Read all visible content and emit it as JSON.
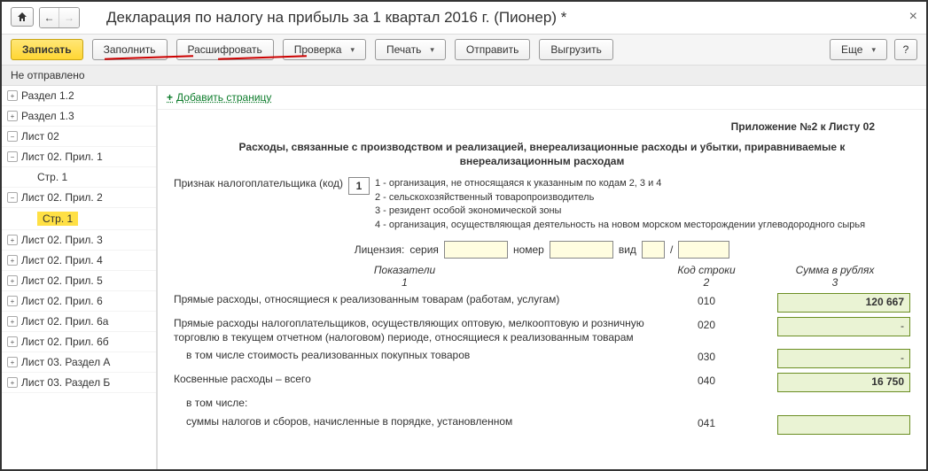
{
  "window": {
    "title": "Декларация по налогу на прибыль за 1 квартал 2016 г. (Пионер) *"
  },
  "toolbar": {
    "record": "Записать",
    "fill": "Заполнить",
    "decode": "Расшифровать",
    "check": "Проверка",
    "print": "Печать",
    "send": "Отправить",
    "export": "Выгрузить",
    "more": "Еще",
    "help": "?"
  },
  "status": "Не отправлено",
  "sidebar": {
    "items": [
      {
        "label": "Раздел 1.2",
        "tog": "+"
      },
      {
        "label": "Раздел 1.3",
        "tog": "+"
      },
      {
        "label": "Лист 02",
        "tog": "−"
      },
      {
        "label": "Лист 02. Прил. 1",
        "tog": "−"
      },
      {
        "label": "Стр. 1",
        "child": true
      },
      {
        "label": "Лист 02. Прил. 2",
        "tog": "−",
        "active": true
      },
      {
        "label": "Стр. 1",
        "child": true,
        "selected": true
      },
      {
        "label": "Лист 02. Прил. 3",
        "tog": "+"
      },
      {
        "label": "Лист 02. Прил. 4",
        "tog": "+"
      },
      {
        "label": "Лист 02. Прил. 5",
        "tog": "+"
      },
      {
        "label": "Лист 02. Прил. 6",
        "tog": "+"
      },
      {
        "label": "Лист 02. Прил. 6а",
        "tog": "+"
      },
      {
        "label": "Лист 02. Прил. 6б",
        "tog": "+"
      },
      {
        "label": "Лист 03. Раздел А",
        "tog": "+"
      },
      {
        "label": "Лист 03. Раздел Б",
        "tog": "+"
      }
    ]
  },
  "content": {
    "add_page": "Добавить страницу",
    "app_title_right": "Приложение №2 к Листу 02",
    "main_title": "Расходы, связанные с производством и реализацией, внереализационные расходы и убытки, приравниваемые к внереализационным расходам",
    "taxpayer_code_label": "Признак налогоплательщика (код)",
    "taxpayer_code": "1",
    "hints": [
      "1 - организация, не относящаяся к указанным по кодам 2, 3 и 4",
      "2 - сельскохозяйственный товаропроизводитель",
      "3 - резидент особой экономической зоны",
      "4 - организация, осуществляющая деятельность на новом морском месторождении углеводородного сырья"
    ],
    "license": {
      "label": "Лицензия:",
      "series": "серия",
      "number": "номер",
      "kind": "вид",
      "slash": "/"
    },
    "cols": {
      "c1": "Показатели",
      "n1": "1",
      "c2": "Код строки",
      "n2": "2",
      "c3": "Сумма в рублях",
      "n3": "3"
    },
    "rows": [
      {
        "label": "Прямые расходы, относящиеся к реализованным товарам (работам, услугам)",
        "code": "010",
        "value": "120 667"
      },
      {
        "label": "Прямые расходы налогоплательщиков, осуществляющих оптовую, мелкооптовую и розничную торговлю в текущем отчетном (налоговом) периоде, относящиеся к реализованным товарам",
        "code": "020",
        "value": "-"
      },
      {
        "label": "в том числе стоимость реализованных покупных товаров",
        "code": "030",
        "value": "-",
        "indent": true
      },
      {
        "label": "Косвенные расходы – всего",
        "code": "040",
        "value": "16 750"
      },
      {
        "label": "в том числе:",
        "code": "",
        "value": "",
        "indent": true,
        "novalue": true
      },
      {
        "label": "суммы налогов и сборов, начисленные в порядке, установленном",
        "code": "041",
        "value": "",
        "indent": true
      }
    ]
  }
}
